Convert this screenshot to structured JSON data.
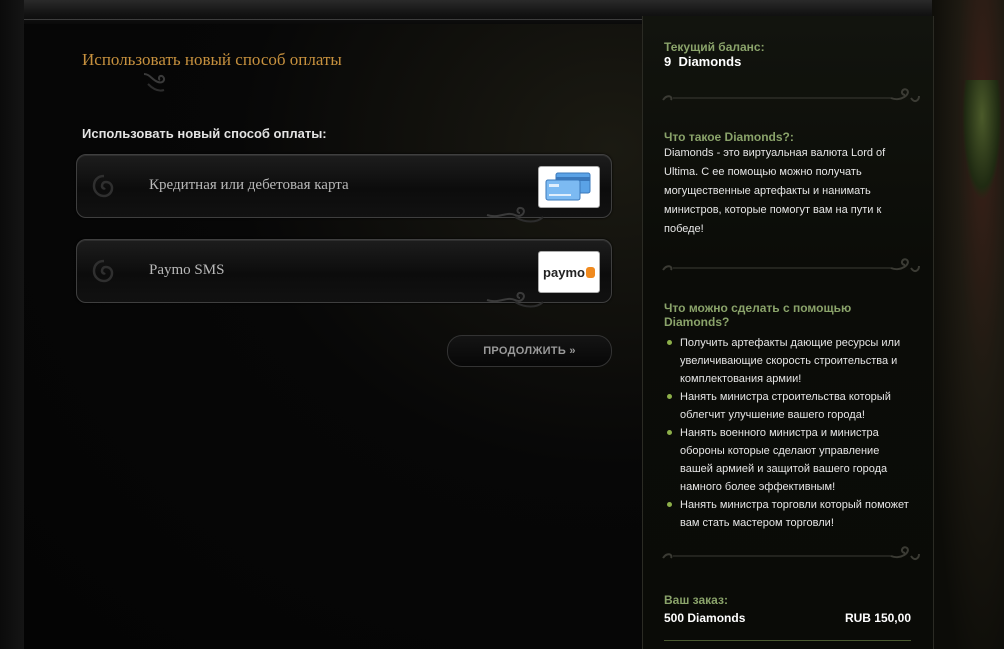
{
  "main": {
    "title": "Использовать новый способ оплаты",
    "subtitle": "Использовать новый способ оплаты:",
    "options": [
      {
        "label": "Кредитная или дебетовая карта",
        "logo": "credit-card-icon"
      },
      {
        "label": "Paymo SMS",
        "logo": "paymo-logo",
        "logo_text": "paymo"
      }
    ],
    "continue_label": "ПРОДОЛЖИТЬ »"
  },
  "sidebar": {
    "balance_label": "Текущий баланс:",
    "balance_value": "9  Diamonds",
    "what_title": "Что такое Diamonds?:",
    "what_text": "Diamonds - это виртуальная валюта Lord of Ultima. С ее помощью можно получать могущественные артефакты и нанимать министров, которые помогут вам на пути к победе!",
    "can_title": "Что можно сделать с помощью Diamonds?",
    "can_items": [
      "Получить артефакты дающие ресурсы или увеличивающие скорость строительства и комплектования армии!",
      "Нанять министра строительства который облегчит улучшение вашего города!",
      "Нанять военного министра и министра обороны которые сделают управление вашей армией и защитой вашего города намного более эффективным!",
      "Нанять министра торговли который поможет вам стать мастером торговли!"
    ],
    "order_label": "Ваш заказ:",
    "order_item": "500 Diamonds",
    "order_price": "RUB 150,00"
  },
  "colors": {
    "title_gold": "#c7913e",
    "sidebar_heading_green": "#8aa36a",
    "bullet_green": "#8db04a"
  }
}
